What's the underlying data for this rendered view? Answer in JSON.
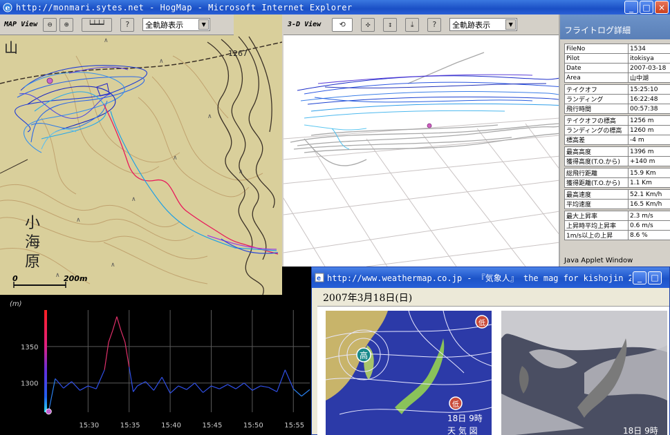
{
  "window": {
    "title": "http://monmari.sytes.net - HogMap - Microsoft Internet Explorer",
    "buttons": [
      "_",
      "□",
      "×"
    ]
  },
  "map_view": {
    "label": "MAP View",
    "select_value": "全軌跡表示",
    "labels": {
      "mountain": "山",
      "elevation": "1267",
      "place1": "小",
      "place2": "海",
      "place3": "原"
    },
    "scale": {
      "zero": "0",
      "distance": "200m"
    }
  },
  "view3d": {
    "label": "3-D View",
    "select_value": "全軌跡表示"
  },
  "flight_log": {
    "heading": "フライトログ詳細",
    "groups": [
      [
        {
          "k": "FileNo",
          "v": "1534"
        },
        {
          "k": "Pilot",
          "v": "itokisya"
        },
        {
          "k": "Date",
          "v": "2007-03-18"
        },
        {
          "k": "Area",
          "v": "山中湖"
        }
      ],
      [
        {
          "k": "テイクオフ",
          "v": "15:25:10"
        },
        {
          "k": "ランディング",
          "v": "16:22:48"
        },
        {
          "k": "飛行時間",
          "v": "00:57:38"
        }
      ],
      [
        {
          "k": "テイクオフの標高",
          "v": "1256 m"
        },
        {
          "k": "ランディングの標高",
          "v": "1260 m"
        },
        {
          "k": "標高差",
          "v": "-4 m"
        }
      ],
      [
        {
          "k": "最高高度",
          "v": "1396 m"
        },
        {
          "k": "獲得高度(T.O.から)",
          "v": "+140 m"
        }
      ],
      [
        {
          "k": "総飛行距離",
          "v": "15.9 Km"
        },
        {
          "k": "獲得距離(T.O.から)",
          "v": "1.1 Km"
        }
      ],
      [
        {
          "k": "最高速度",
          "v": "52.1 Km/h"
        },
        {
          "k": "平均速度",
          "v": "16.5 Km/h"
        }
      ],
      [
        {
          "k": "最大上昇率",
          "v": "2.3 m/s"
        },
        {
          "k": "上昇時平均上昇率",
          "v": "0.6 m/s"
        },
        {
          "k": "1m/s以上の上昇",
          "v": "8.6 %"
        }
      ]
    ],
    "footer": "Java Applet Window"
  },
  "altitude_chart": {
    "unit": "(m)",
    "yticks": [
      "1350",
      "1300"
    ],
    "xticks": [
      "15:30",
      "15:35",
      "15:40",
      "15:45",
      "15:50",
      "15:55"
    ]
  },
  "chart_data": {
    "type": "line",
    "ylabel": "(m)",
    "ylim": [
      1260,
      1400
    ],
    "x_ticks": [
      "15:30",
      "15:35",
      "15:40",
      "15:45",
      "15:50",
      "15:55"
    ],
    "x_minutes": [
      25.2,
      26,
      27,
      28,
      29,
      30,
      31,
      32,
      32.5,
      33,
      33.5,
      34,
      34.5,
      35,
      35.5,
      36,
      37,
      38,
      39,
      40,
      41,
      42,
      43,
      44,
      45,
      46,
      47,
      48,
      49,
      50,
      51,
      52,
      53,
      54,
      55,
      56,
      57
    ],
    "values": [
      1261,
      1306,
      1293,
      1302,
      1290,
      1296,
      1292,
      1318,
      1356,
      1372,
      1391,
      1372,
      1356,
      1322,
      1288,
      1296,
      1302,
      1290,
      1308,
      1286,
      1296,
      1291,
      1300,
      1287,
      1296,
      1292,
      1298,
      1292,
      1300,
      1290,
      1296,
      1294,
      1288,
      1318,
      1292,
      1282,
      1291
    ]
  },
  "weather_popup": {
    "title": "http://www.weathermap.co.jp - 『気象人』 the mag for kishojin 200...",
    "date": "2007年3月18日(日)",
    "map1": {
      "high": "高",
      "low1": "低",
      "low2": "低",
      "time": "18日 9時",
      "caption": "天 気 図"
    },
    "map2": {
      "time": "18日 9時"
    }
  }
}
